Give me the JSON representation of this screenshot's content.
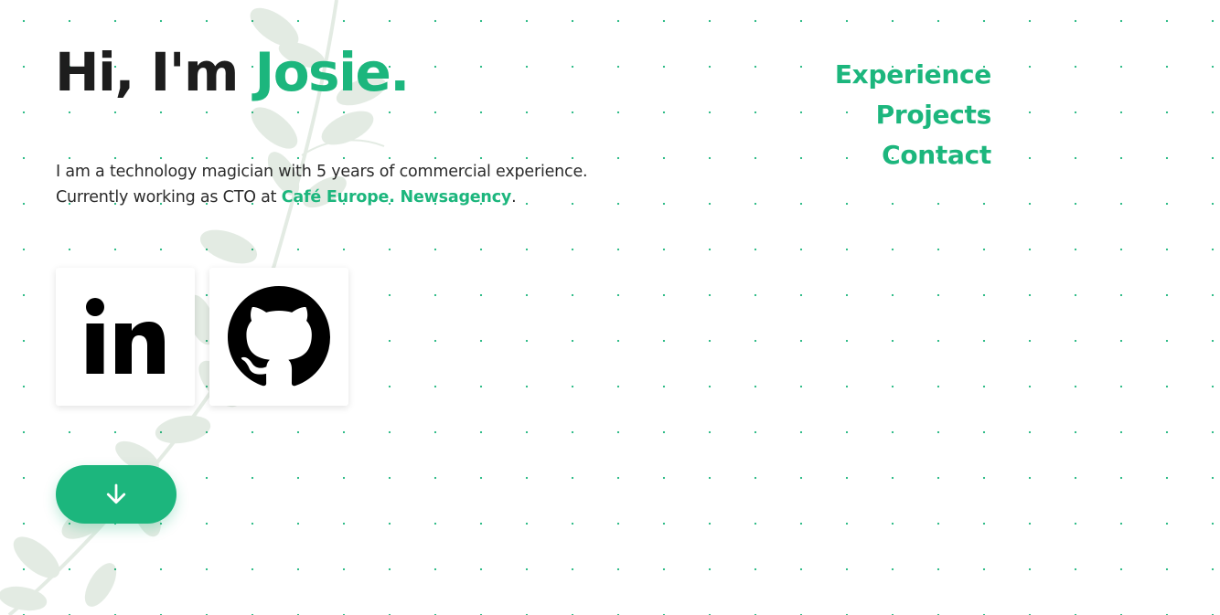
{
  "hero": {
    "greeting": "Hi, I'm",
    "name": "Josie."
  },
  "bio": {
    "line1": "I am a technology magician with 5 years of commercial experience.",
    "line2_prefix": "Currently working as CTO at",
    "company": "Café Europe. Newsagency",
    "line2_suffix": "."
  },
  "nav": {
    "items": [
      {
        "label": "Experience"
      },
      {
        "label": "Projects"
      },
      {
        "label": "Contact"
      }
    ]
  },
  "social": {
    "items": [
      {
        "icon": "linkedin-icon"
      },
      {
        "icon": "github-icon"
      }
    ]
  },
  "scroll_button": {
    "icon": "arrow-down-icon"
  },
  "colors": {
    "accent": "#1cb67d",
    "text": "#1d1d1d",
    "background": "#ffffff"
  }
}
